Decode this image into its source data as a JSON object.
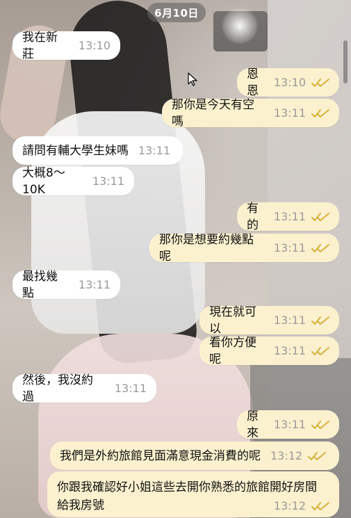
{
  "chat": {
    "date": "6月10日",
    "messages": [
      {
        "dir": "in",
        "text": "我在新莊",
        "time": "13:10"
      },
      {
        "dir": "out",
        "text": "恩恩",
        "time": "13:10",
        "status": "read"
      },
      {
        "dir": "out",
        "text": "那你是今天有空嗎",
        "time": "13:11",
        "status": "read"
      },
      {
        "dir": "in",
        "text": "請問有輔大學生妹嗎",
        "time": "13:11"
      },
      {
        "dir": "in",
        "text": "大概8～10K",
        "time": "13:11"
      },
      {
        "dir": "out",
        "text": "有的",
        "time": "13:11",
        "status": "read"
      },
      {
        "dir": "out",
        "text": "那你是想要約幾點呢",
        "time": "13:11",
        "status": "read"
      },
      {
        "dir": "in",
        "text": "最找幾點",
        "time": "13:11"
      },
      {
        "dir": "out",
        "text": "現在就可以",
        "time": "13:11",
        "status": "read"
      },
      {
        "dir": "out",
        "text": "看你方便呢",
        "time": "13:11",
        "status": "read"
      },
      {
        "dir": "in",
        "text": "然後，我沒約過",
        "time": "13:11"
      },
      {
        "dir": "out",
        "text": "原來",
        "time": "13:11",
        "status": "read"
      },
      {
        "dir": "out",
        "text": "我們是外約旅館見面滿意現金消費的呢",
        "time": "13:12",
        "status": "read"
      },
      {
        "dir": "out",
        "line1": "你跟我確認好小姐這些去開你熟悉的旅館開好房間",
        "line2": "給我房號",
        "time": "13:12",
        "status": "read"
      }
    ]
  },
  "colors": {
    "incoming_bubble": "#ffffff",
    "outgoing_bubble": "#fbf1cf",
    "read_ticks": "#d7b13a",
    "time_text": "#9a9a9a"
  }
}
